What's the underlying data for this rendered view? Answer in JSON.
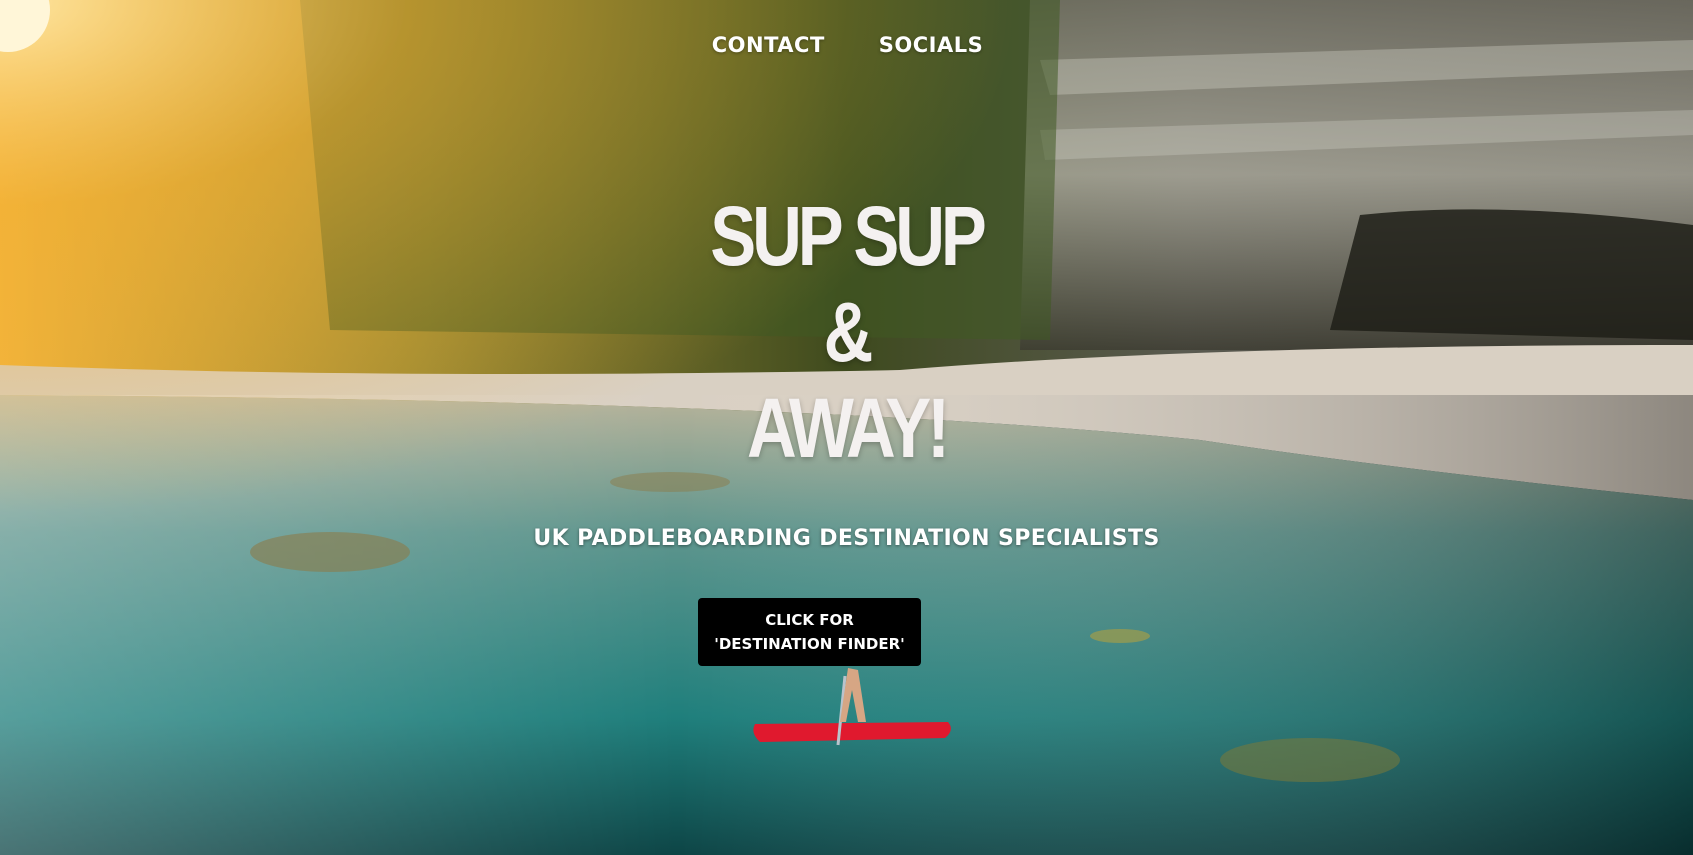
{
  "nav": {
    "items": [
      {
        "label": "CONTACT"
      },
      {
        "label": "SOCIALS"
      }
    ]
  },
  "hero": {
    "title_lines": [
      "SUP SUP",
      "&",
      "AWAY!"
    ],
    "tagline": "UK PADDLEBOARDING DESTINATION SPECIALISTS",
    "cta_line1": "CLICK FOR",
    "cta_line2": "'DESTINATION FINDER'"
  },
  "colors": {
    "cta_bg": "#000000",
    "text": "#ffffff",
    "water": "#2a9a96",
    "cliff": "#4a4a3a",
    "sun": "#f5c24a",
    "board": "#e0192e"
  }
}
